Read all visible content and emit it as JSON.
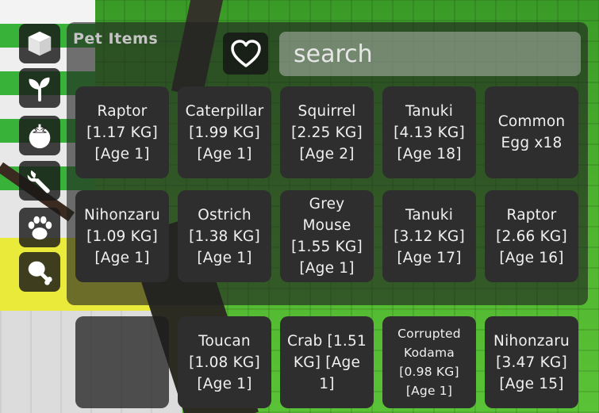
{
  "panel": {
    "title": "Pet Items"
  },
  "search": {
    "placeholder": "search"
  },
  "sidebar": {
    "items": [
      {
        "name": "sidebar-item-inventory",
        "icon": "cube-icon"
      },
      {
        "name": "sidebar-item-seeds",
        "icon": "sprout-icon"
      },
      {
        "name": "sidebar-item-fruits",
        "icon": "tomato-icon"
      },
      {
        "name": "sidebar-item-gear",
        "icon": "wrench-icon"
      },
      {
        "name": "sidebar-item-pets",
        "icon": "paw-icon"
      },
      {
        "name": "sidebar-item-food",
        "icon": "drumstick-icon"
      }
    ]
  },
  "items": [
    {
      "label": "Raptor\n[1.17 KG]\n[Age 1]"
    },
    {
      "label": "Caterpillar\n[1.99 KG]\n[Age 1]"
    },
    {
      "label": "Squirrel\n[2.25 KG]\n[Age 2]"
    },
    {
      "label": "Tanuki\n[4.13 KG]\n[Age 18]"
    },
    {
      "label": "Common\nEgg x18"
    },
    {
      "label": "Nihonzaru\n[1.09 KG]\n[Age 1]"
    },
    {
      "label": "Ostrich\n[1.38 KG]\n[Age 1]"
    },
    {
      "label": "Grey\nMouse\n[1.55 KG]\n[Age 1]"
    },
    {
      "label": "Tanuki\n[3.12 KG]\n[Age 17]"
    },
    {
      "label": "Raptor\n[2.66 KG]\n[Age 16]"
    },
    {
      "label": "Toucan\n[1.08 KG]\n[Age 1]"
    },
    {
      "label": "Crab [1.51\nKG] [Age\n1]"
    },
    {
      "label": "Corrupted\nKodama\n[0.98 KG]\n[Age 1]"
    },
    {
      "label": "Nihonzaru\n[3.47 KG]\n[Age 15]"
    }
  ],
  "colors": {
    "panel_bg": "#202020",
    "card_bg": "#2e2e2e",
    "text": "#f0f0f0",
    "title": "#c4c4c4",
    "grass": "#4fb52f",
    "yellow_floor": "#e9ea3a"
  }
}
